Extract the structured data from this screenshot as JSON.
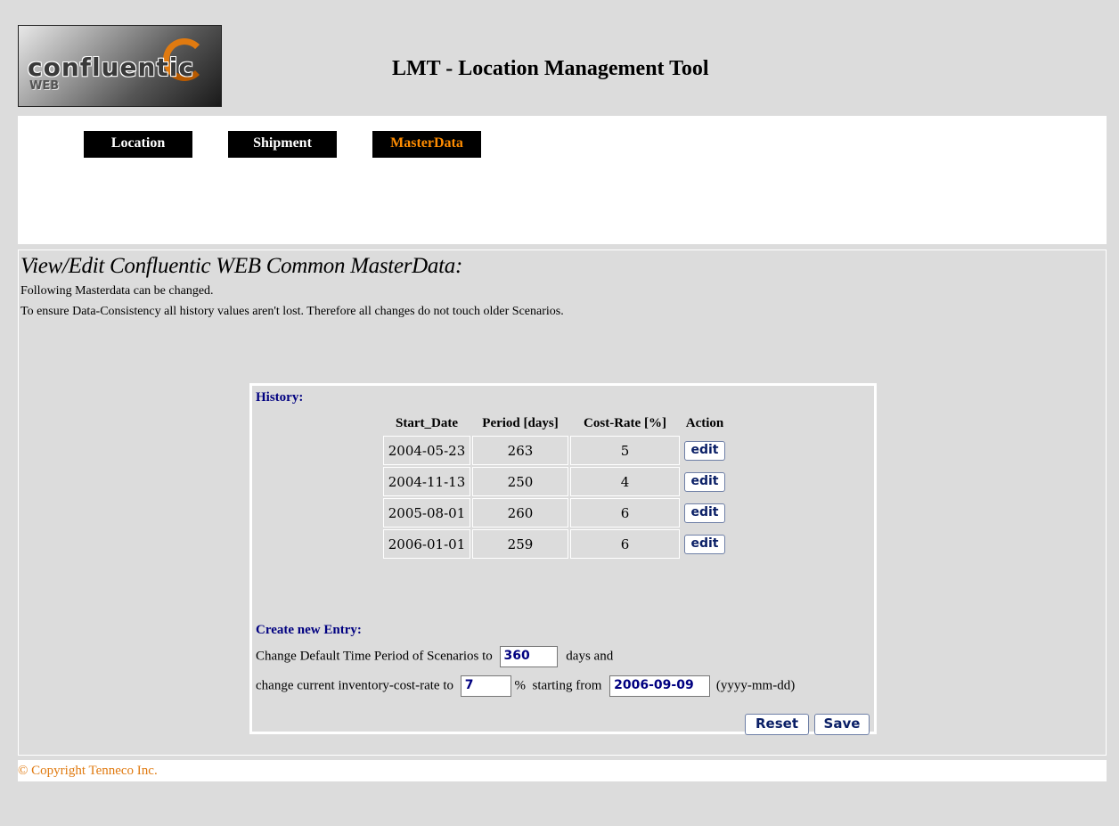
{
  "header": {
    "logo_text": "confluentic",
    "logo_sub": "WEB",
    "title": "LMT - Location Management Tool"
  },
  "nav": {
    "items": [
      {
        "label": "Location",
        "active": false
      },
      {
        "label": "Shipment",
        "active": false
      },
      {
        "label": "MasterData",
        "active": true
      }
    ],
    "active_color": "#ff8c00"
  },
  "main": {
    "title": "View/Edit Confluentic WEB Common MasterData:",
    "desc1": "Following Masterdata can be changed.",
    "desc2": "To ensure Data-Consistency all history values aren't lost. Therefore all changes do not touch older Scenarios."
  },
  "history": {
    "label": "History:",
    "columns": [
      "Start_Date",
      "Period [days]",
      "Cost-Rate [%]",
      "Action"
    ],
    "rows": [
      {
        "start_date": "2004-05-23",
        "period": "263",
        "cost_rate": "5",
        "action": "edit"
      },
      {
        "start_date": "2004-11-13",
        "period": "250",
        "cost_rate": "4",
        "action": "edit"
      },
      {
        "start_date": "2005-08-01",
        "period": "260",
        "cost_rate": "6",
        "action": "edit"
      },
      {
        "start_date": "2006-01-01",
        "period": "259",
        "cost_rate": "6",
        "action": "edit"
      }
    ]
  },
  "new_entry": {
    "label": "Create new Entry:",
    "line1_prefix": "Change Default Time Period of Scenarios to",
    "period_value": "360",
    "line1_suffix": "days and",
    "line2_prefix": "change current inventory-cost-rate to",
    "rate_value": "7",
    "line2_mid": "%  starting from",
    "date_value": "2006-09-09",
    "date_format": "(yyyy-mm-dd)",
    "reset_label": "Reset",
    "save_label": "Save"
  },
  "footer": {
    "copyright": "© Copyright Tenneco Inc."
  },
  "colors": {
    "background": "#dcdcdc",
    "section_label": "#000080",
    "footer_text": "#e07a10"
  }
}
